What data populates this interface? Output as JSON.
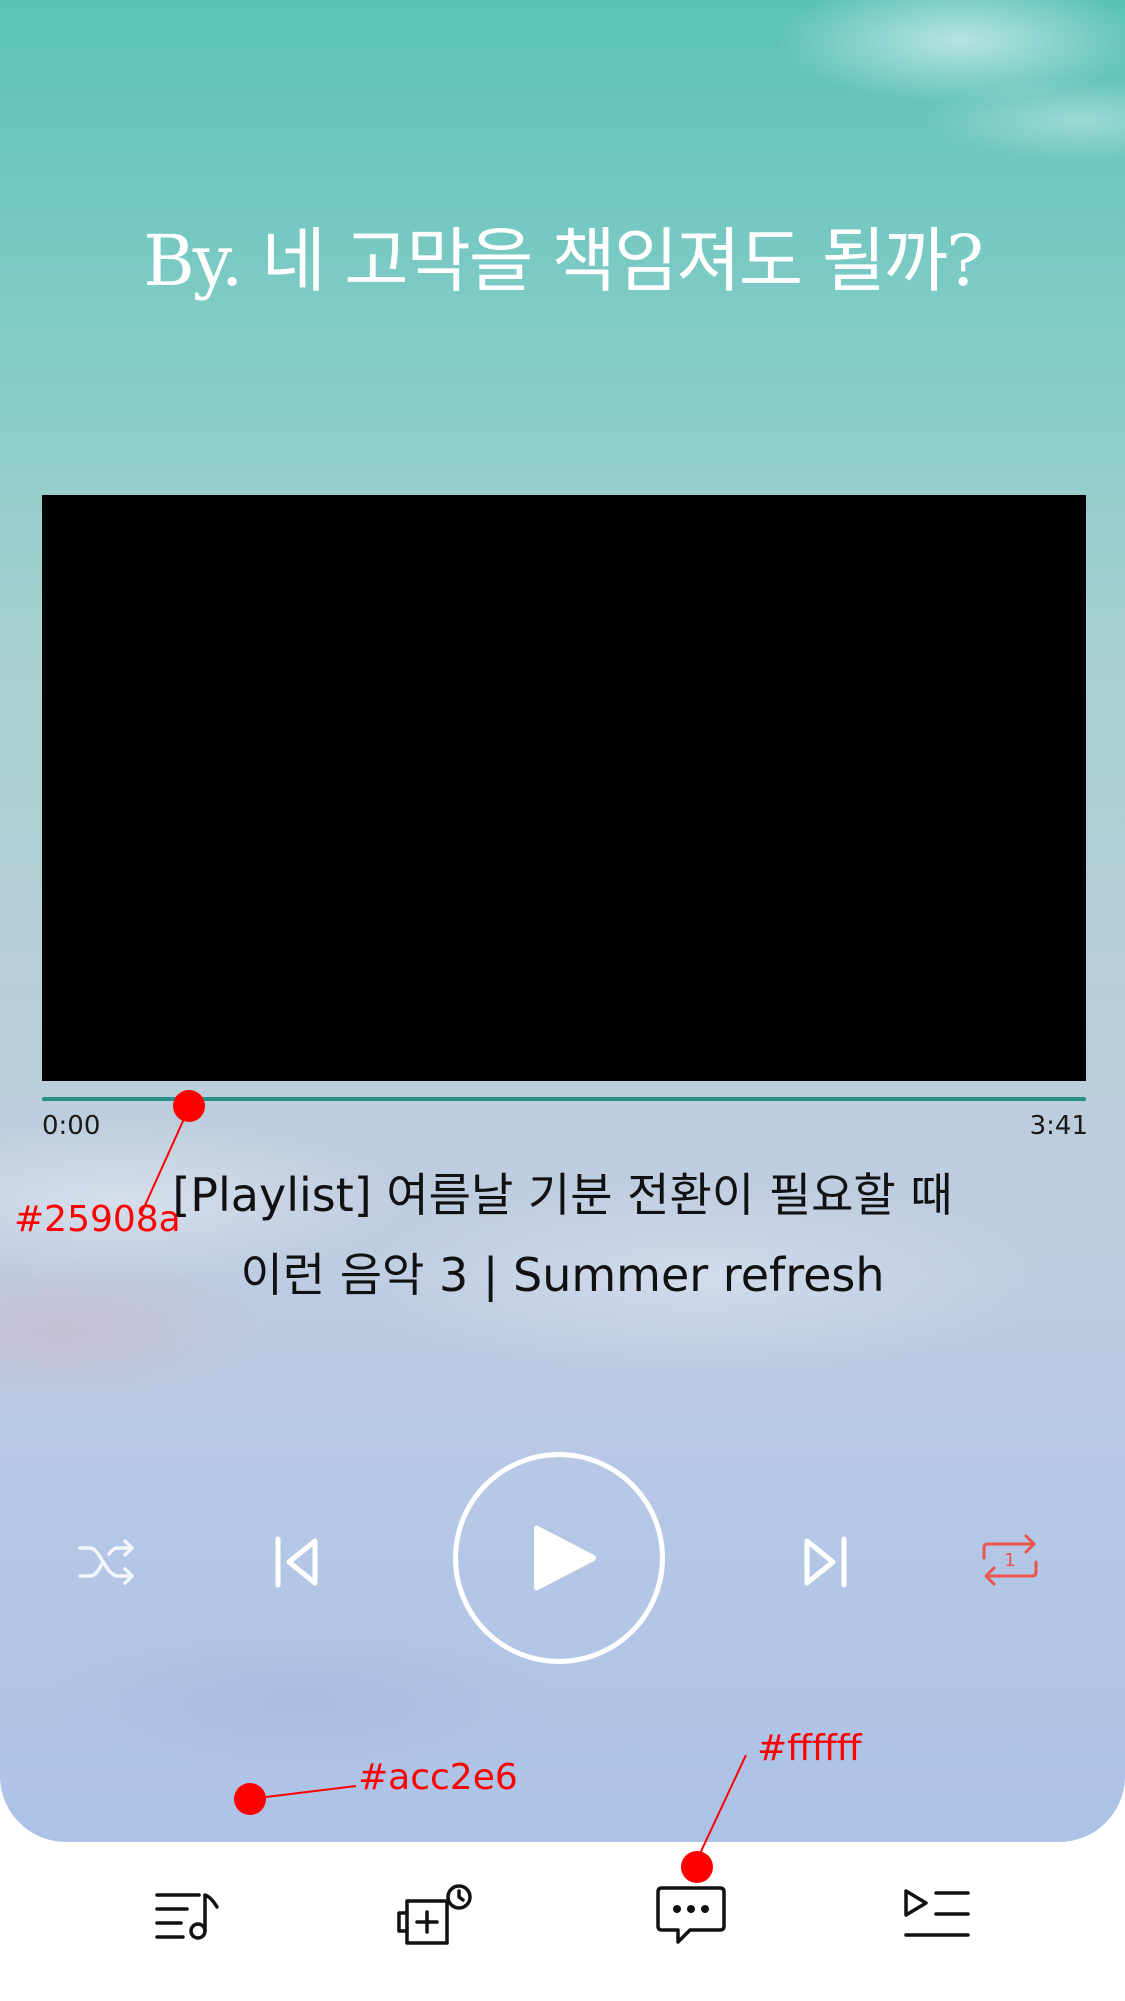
{
  "header": {
    "title": "By. 네 고막을 책임져도 될까?"
  },
  "player": {
    "elapsed": "0:00",
    "duration": "3:41",
    "progress_fraction": 0.0,
    "video_title_line1": "[Playlist] 여름날 기분 전환이 필요할 때",
    "video_title_line2": "이런 음악 3 | Summer refresh"
  },
  "controls": {
    "shuffle_icon": "shuffle-icon",
    "previous_icon": "skip-previous-icon",
    "play_icon": "play-icon",
    "next_icon": "skip-next-icon",
    "repeat_icon": "repeat-one-icon",
    "repeat_badge": "1"
  },
  "tabbar": {
    "items": [
      {
        "icon": "playlist-music-icon"
      },
      {
        "icon": "add-timer-icon"
      },
      {
        "icon": "chat-bubble-icon"
      },
      {
        "icon": "play-queue-icon"
      }
    ]
  },
  "annotations": {
    "progress_color_label": "#25908a",
    "background_color_label": "#acc2e6",
    "tabbar_color_label": "#ffffff"
  },
  "colors": {
    "accent": "#25908a",
    "background_bottom": "#acc2e6",
    "tabbar": "#ffffff",
    "repeat_active": "#e8564f",
    "annotation": "#ff0000"
  }
}
